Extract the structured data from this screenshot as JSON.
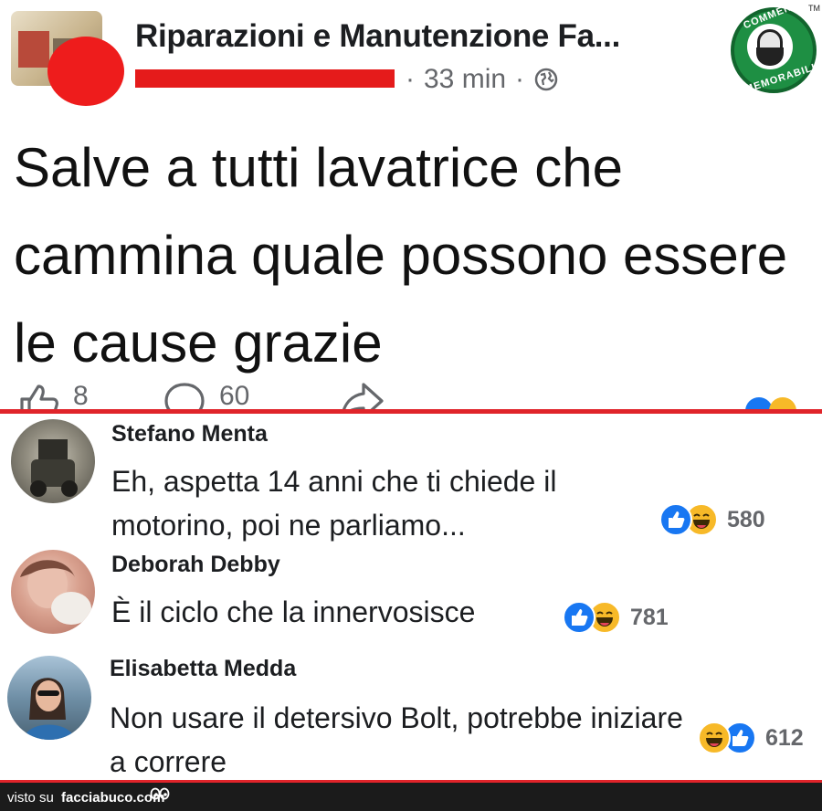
{
  "post": {
    "page_name": "Riparazioni e Manutenzione Fa...",
    "time": "33 min",
    "separator": "·",
    "text": "Salve a tutti lavatrice che cammina quale possono essere le cause grazie",
    "badge": {
      "top": "COMMENTI",
      "bottom": "MEMORABILI",
      "tm": "TM"
    },
    "actions": {
      "like_count": "8",
      "comment_count": "60"
    },
    "colors": {
      "redaction": "#e51b1b",
      "divider": "#e0242a",
      "badge_green": "#1e8f43"
    }
  },
  "comments": [
    {
      "name": "Stefano Menta",
      "text": "Eh, aspetta 14 anni che ti chiede il motorino, poi ne parliamo...",
      "reaction_count": "580",
      "reactions": [
        "like-icon",
        "haha-icon"
      ]
    },
    {
      "name": "Deborah Debby",
      "text": "È il ciclo che la innervosisce",
      "reaction_count": "781",
      "reactions": [
        "like-icon",
        "haha-icon"
      ]
    },
    {
      "name": "Elisabetta Medda",
      "text": "Non usare il detersivo Bolt, potrebbe iniziare a correre",
      "reaction_count": "612",
      "reactions": [
        "haha-icon",
        "like-icon"
      ]
    }
  ],
  "footer": {
    "prefix": "visto su",
    "site": "facciabuco.com",
    "icon": "eyes-icon"
  }
}
